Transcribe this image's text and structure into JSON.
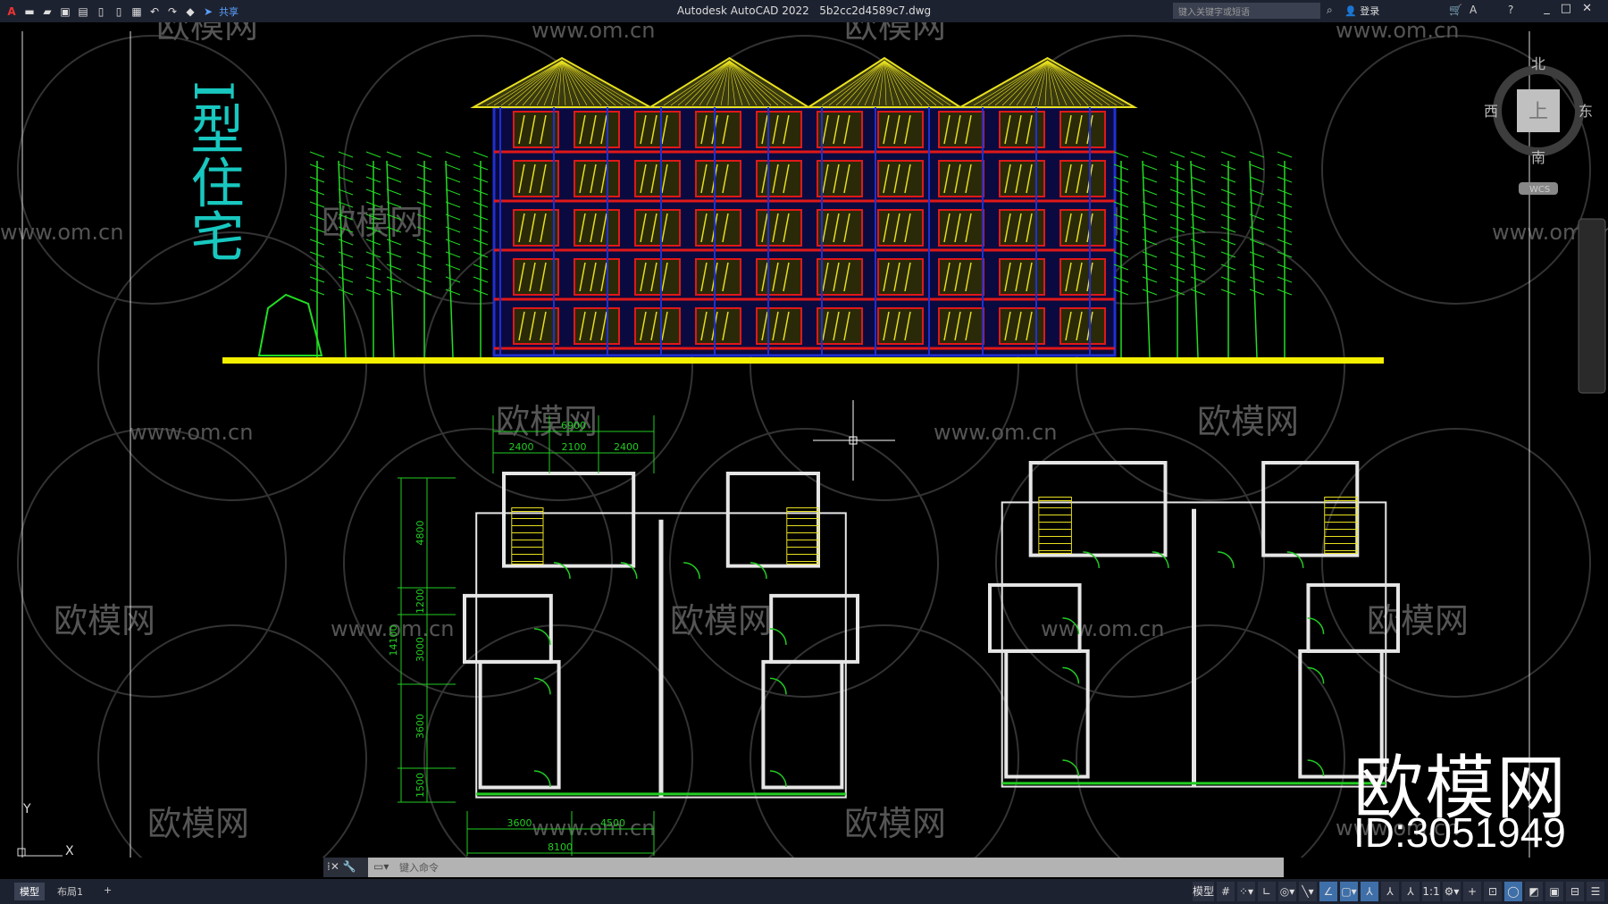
{
  "titlebar": {
    "app_title": "Autodesk AutoCAD 2022",
    "file_name": "5b2cc2d4589c7.dwg",
    "share_label": "共享",
    "search_placeholder": "键入关键字或短语",
    "login_label": "登录",
    "quick_access": [
      "new-icon",
      "open-icon",
      "save-icon",
      "saveas-icon",
      "plot-icon",
      "undo-icon",
      "redo-icon"
    ]
  },
  "drawing": {
    "title": "I型住宅",
    "colors": {
      "background": "#000000",
      "wall": "#e6e6e6",
      "dimension": "#22cc22",
      "ground": "#f5f000",
      "title": "#18c8c0",
      "elevation_frame": "#2030d0",
      "elevation_red": "#e01818",
      "elevation_yellow": "#e8e020"
    },
    "left_plan_dims": {
      "top_total": "6900",
      "top_parts": [
        "2400",
        "2100",
        "2400"
      ],
      "left_total": "14100",
      "left_parts": [
        "4800",
        "1200",
        "3000",
        "3600",
        "1500"
      ],
      "bottom_parts": [
        "3600",
        "4500"
      ],
      "bottom_total": "8100"
    }
  },
  "watermarks": {
    "text_url": "www.om.cn",
    "text_brand": "欧模网",
    "big_brand": "欧模网",
    "id": "ID:3051949"
  },
  "viewcube": {
    "north": "北",
    "south": "南",
    "east": "东",
    "west": "西",
    "face": "上",
    "ucs": "WCS"
  },
  "ucs_icon": {
    "x": "X",
    "y": "Y"
  },
  "command": {
    "placeholder": "键入命令"
  },
  "layout_tabs": [
    {
      "label": "模型",
      "active": true
    },
    {
      "label": "布局1",
      "active": false
    }
  ],
  "add_tab": "+",
  "statusbar": {
    "model_label": "模型",
    "scale": "1:1",
    "tools": [
      "grid-icon",
      "snap-icon",
      "ortho-icon",
      "polar-icon",
      "isodraft-icon",
      "osnap-icon",
      "lineweight-icon",
      "annotation-icon",
      "workspace-icon",
      "customize-icon"
    ]
  }
}
